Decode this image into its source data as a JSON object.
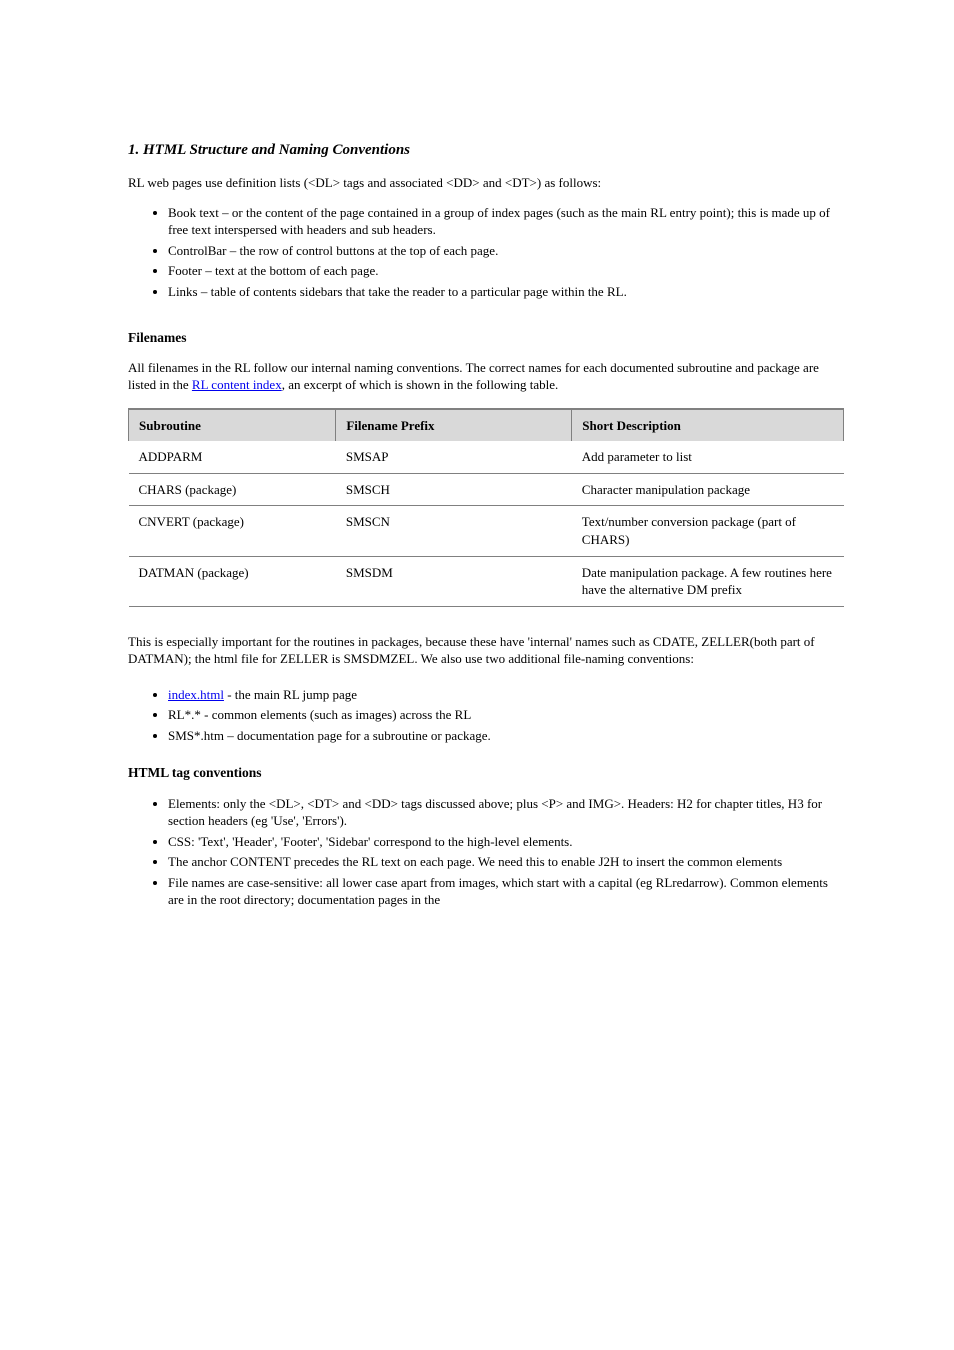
{
  "section1": {
    "title": "1. HTML Structure and Naming Conventions",
    "lead_in": "RL web pages use definition lists (<DL> tags and associated <DD> and <DT>) as follows:",
    "bullets": [
      "Book text – or the content of the page contained in a group of index pages (such as the main RL entry point); this is made up of free text interspersed with headers and sub headers.",
      "ControlBar – the row of control buttons at the top of each page.",
      "Footer – text at the bottom of each page.",
      "Links – table of contents sidebars that take the reader to a particular page within the RL."
    ],
    "subsection": {
      "title": "Filenames",
      "para1_pre": "All filenames in the RL follow our internal naming conventions. The correct names for each documented subroutine and package are listed in the ",
      "para1_linktext": "RL content index",
      "para1_post": ", an excerpt of which is shown in the following table.",
      "table": {
        "headers": [
          "Subroutine",
          "Filename Prefix",
          "Short Description"
        ],
        "rows": [
          [
            "ADDPARM",
            "SMSAP",
            "Add parameter to list"
          ],
          [
            "CHARS (package)",
            "SMSCH",
            "Character manipulation package"
          ],
          [
            "CNVERT (package)",
            "SMSCN",
            "Text/number conversion package (part of CHARS)"
          ],
          [
            "DATMAN (package)",
            "SMSDM",
            "Date manipulation package. A few routines here have the alternative DM prefix"
          ]
        ]
      },
      "para2": "This is especially important for the routines in packages, because these have 'internal' names such as CDATE, ZELLER(both part of DATMAN); the html file for ZELLER is SMSDMZEL. We also use two additional file-naming conventions:"
    }
  },
  "section2": {
    "indextext": "index.html",
    "bullets1": [
      " - the main RL jump page",
      "RL*.* - common elements (such as images) across the RL",
      "SMS*.htm – documentation page for a subroutine or package."
    ],
    "subsection": {
      "title": "HTML tag conventions",
      "bullets": [
        "Elements: only the <DL>, <DT> and <DD> tags discussed above; plus <P> and IMG>. Headers: H2 for chapter titles, H3 for section headers (eg 'Use', 'Errors').",
        "CSS: 'Text', 'Header', 'Footer', 'Sidebar' correspond to the high-level elements.",
        "The anchor CONTENT precedes the RL text on each page. We need this to enable J2H to insert the common elements",
        "File names are case-sensitive: all lower case apart from images, which start with a capital (eg RLredarrow). Common elements are in the root directory; documentation pages in the"
      ]
    }
  }
}
